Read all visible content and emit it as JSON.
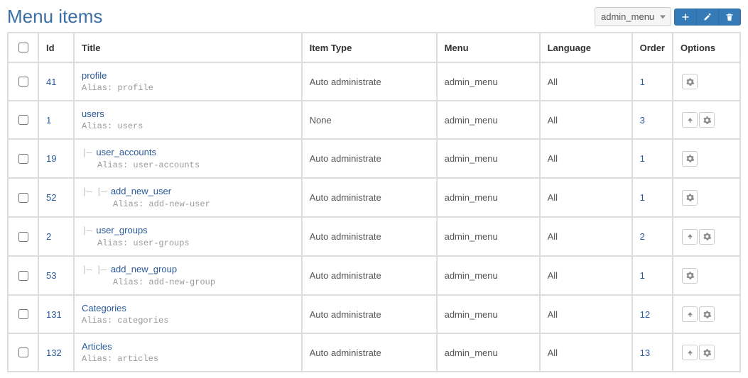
{
  "header": {
    "title": "Menu items",
    "select_value": "admin_menu"
  },
  "columns": {
    "check": "",
    "id": "Id",
    "title": "Title",
    "type": "Item Type",
    "menu": "Menu",
    "lang": "Language",
    "order": "Order",
    "opts": "Options"
  },
  "alias_label": "Alias:",
  "rows": [
    {
      "id": "41",
      "indent": 0,
      "title": "profile",
      "alias": "profile",
      "type": "Auto administrate",
      "menu": "admin_menu",
      "lang": "All",
      "order": "1",
      "has_up": false
    },
    {
      "id": "1",
      "indent": 0,
      "title": "users",
      "alias": "users",
      "type": "None",
      "menu": "admin_menu",
      "lang": "All",
      "order": "3",
      "has_up": true
    },
    {
      "id": "19",
      "indent": 1,
      "title": "user_accounts",
      "alias": "user-accounts",
      "type": "Auto administrate",
      "menu": "admin_menu",
      "lang": "All",
      "order": "1",
      "has_up": false
    },
    {
      "id": "52",
      "indent": 2,
      "title": "add_new_user",
      "alias": "add-new-user",
      "type": "Auto administrate",
      "menu": "admin_menu",
      "lang": "All",
      "order": "1",
      "has_up": false
    },
    {
      "id": "2",
      "indent": 1,
      "title": "user_groups",
      "alias": "user-groups",
      "type": "Auto administrate",
      "menu": "admin_menu",
      "lang": "All",
      "order": "2",
      "has_up": true
    },
    {
      "id": "53",
      "indent": 2,
      "title": "add_new_group",
      "alias": "add-new-group",
      "type": "Auto administrate",
      "menu": "admin_menu",
      "lang": "All",
      "order": "1",
      "has_up": false
    },
    {
      "id": "131",
      "indent": 0,
      "title": "Categories",
      "alias": "categories",
      "type": "Auto administrate",
      "menu": "admin_menu",
      "lang": "All",
      "order": "12",
      "has_up": true
    },
    {
      "id": "132",
      "indent": 0,
      "title": "Articles",
      "alias": "articles",
      "type": "Auto administrate",
      "menu": "admin_menu",
      "lang": "All",
      "order": "13",
      "has_up": true
    }
  ]
}
